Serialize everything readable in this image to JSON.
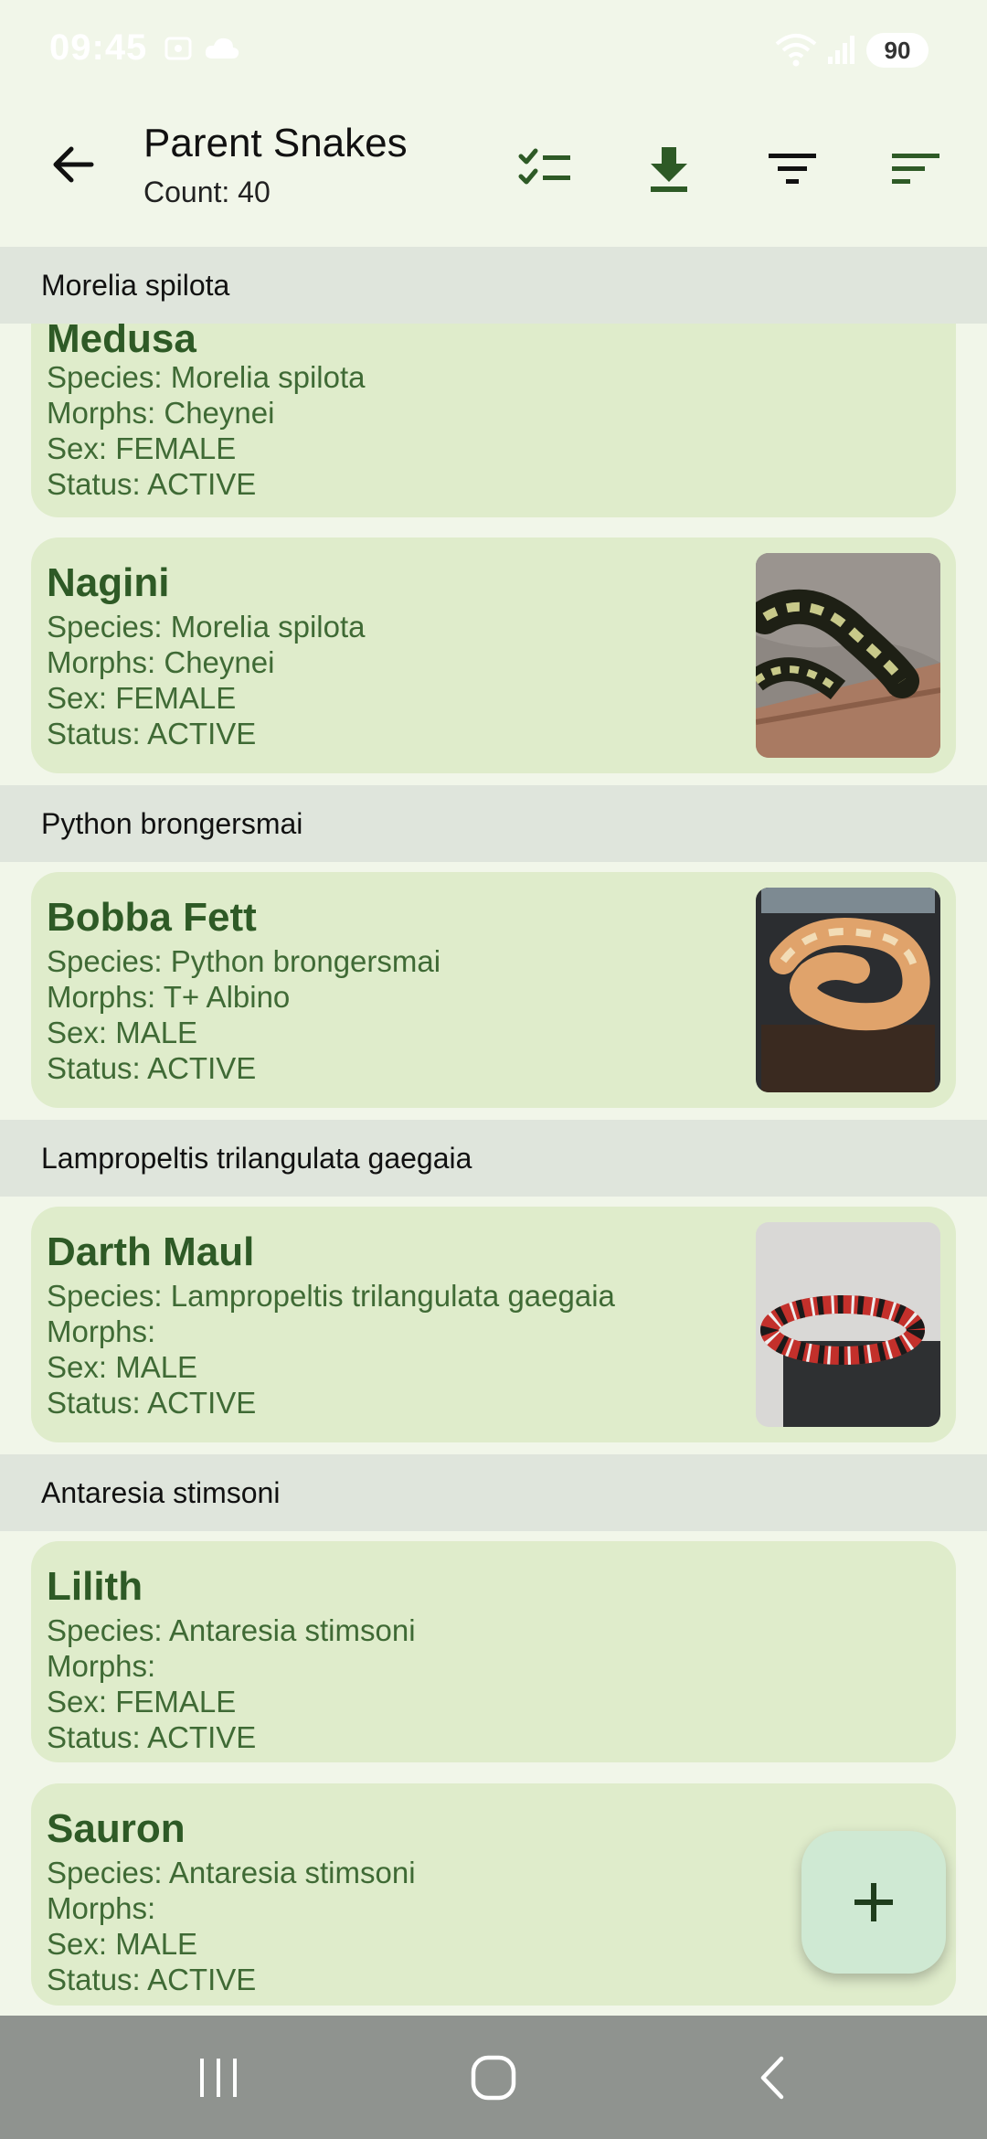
{
  "status_bar": {
    "time": "09:45",
    "battery": "90",
    "icons": [
      "screenshot-icon",
      "cloud-icon",
      "wifi-icon",
      "signal-icon"
    ]
  },
  "app_bar": {
    "title": "Parent Snakes",
    "subtitle": "Count: 40",
    "actions": [
      "select-all-icon",
      "download-icon",
      "filter-icon",
      "sort-icon"
    ]
  },
  "colors": {
    "background": "#f1f6e9",
    "card": "#dfeccb",
    "section_header": "#dfe5dc",
    "primary_text": "#2e5a26",
    "fab": "#cfe9d3",
    "nav_bar": "#8f938f"
  },
  "sections": [
    {
      "header": "Morelia spilota",
      "cards": [
        {
          "name": "Medusa",
          "species": "Species: Morelia spilota",
          "morphs": "Morphs: Cheynei",
          "sex": "Sex: FEMALE",
          "status": "Status: ACTIVE"
        },
        {
          "name": "Nagini",
          "species": "Species: Morelia spilota",
          "morphs": "Morphs: Cheynei",
          "sex": "Sex: FEMALE",
          "status": "Status: ACTIVE",
          "photo": "carpet-python-photo"
        }
      ]
    },
    {
      "header": "Python brongersmai",
      "cards": [
        {
          "name": "Bobba Fett",
          "species": "Species: Python brongersmai",
          "morphs": "Morphs: T+ Albino",
          "sex": "Sex: MALE",
          "status": "Status: ACTIVE",
          "photo": "albino-python-photo"
        }
      ]
    },
    {
      "header": "Lampropeltis trilangulata gaegaia",
      "cards": [
        {
          "name": "Darth Maul",
          "species": "Species: Lampropeltis trilangulata gaegaia",
          "morphs": "Morphs:",
          "sex": "Sex: MALE",
          "status": "Status: ACTIVE",
          "photo": "milk-snake-photo"
        }
      ]
    },
    {
      "header": "Antaresia  stimsoni",
      "cards": [
        {
          "name": "Lilith",
          "species": "Species: Antaresia  stimsoni",
          "morphs": "Morphs:",
          "sex": "Sex: FEMALE",
          "status": "Status: ACTIVE"
        },
        {
          "name": "Sauron",
          "species": "Species: Antaresia  stimsoni",
          "morphs": "Morphs:",
          "sex": "Sex: MALE",
          "status": "Status: ACTIVE"
        }
      ]
    }
  ],
  "fab": {
    "icon": "plus-icon"
  },
  "nav_bar": {
    "buttons": [
      "recent-apps-icon",
      "home-icon",
      "back-nav-icon"
    ]
  }
}
